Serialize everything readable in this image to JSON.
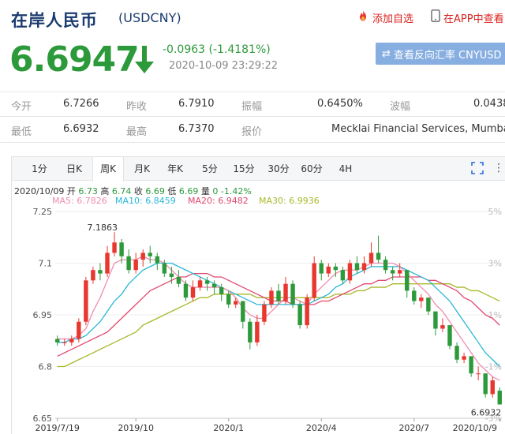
{
  "header": {
    "title": "在岸人民币",
    "code": "(USDCNY)",
    "add_fav": "添加自选",
    "app_view": "在APP中查看"
  },
  "quote": {
    "price": "6.6947",
    "change": "-0.0963 (-1.4181%)",
    "timestamp": "2020-10-09 23:29:22",
    "reverse_button": "查看反向汇率 CNYUSD"
  },
  "stats": {
    "open_label": "今开",
    "open": "6.7266",
    "prev_label": "昨收",
    "prev": "6.7910",
    "amp_label": "振幅",
    "amp": "0.6450%",
    "vol_label": "波幅",
    "vol": "0.0438",
    "low_label": "最低",
    "low": "6.6932",
    "high_label": "最高",
    "high": "6.7370",
    "quote_label": "报价",
    "quoter": "Mecklai Financial Services, Mumbai"
  },
  "tabs": [
    {
      "label": "1分"
    },
    {
      "label": "日K"
    },
    {
      "label": "周K"
    },
    {
      "label": "月K"
    },
    {
      "label": "年K"
    },
    {
      "label": "5分"
    },
    {
      "label": "15分"
    },
    {
      "label": "30分"
    },
    {
      "label": "60分"
    },
    {
      "label": "4H"
    }
  ],
  "active_tab": "周K",
  "ohlc": {
    "date": "2020/10/09",
    "open_label": "开",
    "open": "6.73",
    "high_label": "高",
    "high": "6.74",
    "close_label": "收",
    "close": "6.69",
    "low_label": "低",
    "low": "6.69",
    "volume_label": "量",
    "volume": "0",
    "change": "-1.42%"
  },
  "ma_legend": [
    {
      "label": "MA5: 6.7826",
      "color": "#f08cb0"
    },
    {
      "label": "MA10: 6.8459",
      "color": "#2ab7d6"
    },
    {
      "label": "MA20: 6.9482",
      "color": "#e0486e"
    },
    {
      "label": "MA30: 6.9936",
      "color": "#a8b82a"
    }
  ],
  "colors": {
    "up": "#e8372f",
    "down": "#2c9a3a",
    "accent": "#1a3a6e",
    "button": "#87aee0"
  },
  "chart_data": {
    "type": "candlestick",
    "title": "",
    "ylim": [
      6.65,
      7.25
    ],
    "y_ticks": [
      "7.25",
      "7.1",
      "6.95",
      "6.8",
      "6.65"
    ],
    "pct_ticks": [
      "5%",
      "3%",
      "1%",
      "-1%",
      "-3%"
    ],
    "x_ticks": [
      "2019/7/19",
      "2019/10",
      "2020/1",
      "2020/4",
      "2020/7",
      "2020/10/9"
    ],
    "x_tick_index": [
      0,
      11,
      24,
      37,
      50,
      62
    ],
    "annotations": {
      "max": "7.1863",
      "min": "6.6932"
    },
    "candles": [
      [
        6.88,
        6.87,
        6.89,
        6.86
      ],
      [
        6.87,
        6.87,
        6.88,
        6.86
      ],
      [
        6.87,
        6.88,
        6.89,
        6.86
      ],
      [
        6.88,
        6.93,
        6.94,
        6.87
      ],
      [
        6.93,
        7.05,
        7.06,
        6.92
      ],
      [
        7.05,
        7.08,
        7.09,
        7.04
      ],
      [
        7.08,
        7.07,
        7.1,
        7.05
      ],
      [
        7.07,
        7.13,
        7.15,
        7.06
      ],
      [
        7.13,
        7.16,
        7.19,
        7.12
      ],
      [
        7.16,
        7.12,
        7.17,
        7.1
      ],
      [
        7.12,
        7.08,
        7.14,
        7.07
      ],
      [
        7.08,
        7.11,
        7.13,
        7.07
      ],
      [
        7.11,
        7.13,
        7.14,
        7.09
      ],
      [
        7.13,
        7.12,
        7.15,
        7.1
      ],
      [
        7.12,
        7.1,
        7.13,
        7.08
      ],
      [
        7.1,
        7.07,
        7.11,
        7.06
      ],
      [
        7.07,
        7.06,
        7.09,
        7.04
      ],
      [
        7.06,
        7.04,
        7.08,
        7.03
      ],
      [
        7.04,
        7.0,
        7.05,
        6.99
      ],
      [
        7.0,
        7.03,
        7.05,
        6.99
      ],
      [
        7.03,
        7.05,
        7.06,
        7.02
      ],
      [
        7.05,
        7.04,
        7.06,
        7.02
      ],
      [
        7.04,
        7.03,
        7.05,
        7.01
      ],
      [
        7.03,
        7.01,
        7.04,
        6.99
      ],
      [
        7.01,
        6.98,
        7.02,
        6.97
      ],
      [
        6.98,
        6.99,
        7.0,
        6.97
      ],
      [
        6.99,
        6.93,
        6.99,
        6.91
      ],
      [
        6.93,
        6.87,
        6.94,
        6.85
      ],
      [
        6.87,
        6.93,
        6.95,
        6.86
      ],
      [
        6.93,
        6.98,
        6.99,
        6.92
      ],
      [
        6.98,
        7.02,
        7.03,
        6.97
      ],
      [
        7.02,
        6.99,
        7.04,
        6.98
      ],
      [
        6.99,
        7.04,
        7.06,
        6.98
      ],
      [
        7.04,
        6.98,
        7.05,
        6.97
      ],
      [
        6.98,
        6.92,
        6.99,
        6.91
      ],
      [
        6.92,
        7.0,
        7.01,
        6.91
      ],
      [
        7.0,
        7.1,
        7.12,
        6.99
      ],
      [
        7.1,
        7.07,
        7.11,
        7.05
      ],
      [
        7.07,
        7.09,
        7.1,
        7.06
      ],
      [
        7.09,
        7.08,
        7.1,
        7.06
      ],
      [
        7.08,
        7.05,
        7.09,
        7.04
      ],
      [
        7.05,
        7.1,
        7.11,
        7.04
      ],
      [
        7.1,
        7.08,
        7.12,
        7.07
      ],
      [
        7.08,
        7.1,
        7.12,
        7.07
      ],
      [
        7.1,
        7.13,
        7.16,
        7.09
      ],
      [
        7.13,
        7.11,
        7.18,
        7.1
      ],
      [
        7.11,
        7.08,
        7.12,
        7.07
      ],
      [
        7.08,
        7.07,
        7.09,
        7.05
      ],
      [
        7.07,
        7.08,
        7.1,
        7.06
      ],
      [
        7.08,
        7.02,
        7.08,
        7.0
      ],
      [
        7.02,
        6.99,
        7.03,
        6.98
      ],
      [
        6.99,
        7.0,
        7.01,
        6.97
      ],
      [
        7.0,
        6.96,
        7.0,
        6.95
      ],
      [
        6.96,
        6.91,
        6.96,
        6.89
      ],
      [
        6.91,
        6.92,
        6.94,
        6.9
      ],
      [
        6.92,
        6.86,
        6.92,
        6.85
      ],
      [
        6.86,
        6.82,
        6.87,
        6.81
      ],
      [
        6.82,
        6.83,
        6.84,
        6.81
      ],
      [
        6.83,
        6.78,
        6.83,
        6.77
      ],
      [
        6.78,
        6.78,
        6.8,
        6.76
      ],
      [
        6.78,
        6.72,
        6.78,
        6.71
      ],
      [
        6.72,
        6.76,
        6.77,
        6.71
      ],
      [
        6.73,
        6.69,
        6.74,
        6.69
      ]
    ],
    "ma5": [
      6.88,
      6.88,
      6.88,
      6.89,
      6.91,
      6.96,
      7.0,
      7.05,
      7.1,
      7.11,
      7.11,
      7.11,
      7.12,
      7.11,
      7.11,
      7.1,
      7.08,
      7.06,
      7.04,
      7.03,
      7.03,
      7.03,
      7.03,
      7.03,
      7.02,
      7.0,
      6.97,
      6.95,
      6.94,
      6.94,
      6.96,
      6.98,
      7.0,
      7.0,
      6.99,
      6.98,
      7.01,
      7.03,
      7.05,
      7.07,
      7.08,
      7.08,
      7.08,
      7.09,
      7.1,
      7.1,
      7.1,
      7.1,
      7.09,
      7.07,
      7.05,
      7.03,
      7.01,
      6.98,
      6.96,
      6.93,
      6.9,
      6.87,
      6.84,
      6.81,
      6.79,
      6.77,
      6.76
    ],
    "ma10": [
      6.87,
      6.87,
      6.88,
      6.88,
      6.89,
      6.91,
      6.93,
      6.96,
      6.99,
      7.01,
      7.04,
      7.06,
      7.08,
      7.09,
      7.1,
      7.1,
      7.1,
      7.09,
      7.08,
      7.07,
      7.06,
      7.05,
      7.04,
      7.03,
      7.02,
      7.01,
      7.0,
      6.99,
      6.98,
      6.98,
      6.98,
      6.98,
      6.98,
      6.98,
      6.98,
      6.98,
      6.99,
      7.0,
      7.01,
      7.03,
      7.04,
      7.06,
      7.07,
      7.08,
      7.09,
      7.09,
      7.09,
      7.09,
      7.09,
      7.08,
      7.07,
      7.06,
      7.05,
      7.03,
      7.01,
      6.99,
      6.96,
      6.93,
      6.9,
      6.87,
      6.84,
      6.82,
      6.8
    ],
    "ma20": [
      6.83,
      6.84,
      6.85,
      6.86,
      6.87,
      6.88,
      6.89,
      6.9,
      6.92,
      6.94,
      6.96,
      6.98,
      7.0,
      7.02,
      7.03,
      7.04,
      7.05,
      7.06,
      7.06,
      7.07,
      7.07,
      7.07,
      7.06,
      7.06,
      7.05,
      7.04,
      7.03,
      7.02,
      7.01,
      7.0,
      6.99,
      6.99,
      6.99,
      6.98,
      6.98,
      6.98,
      6.98,
      6.99,
      6.99,
      7.0,
      7.01,
      7.02,
      7.03,
      7.04,
      7.04,
      7.05,
      7.05,
      7.06,
      7.06,
      7.06,
      7.06,
      7.06,
      7.05,
      7.05,
      7.04,
      7.03,
      7.02,
      7.0,
      6.99,
      6.97,
      6.95,
      6.94,
      6.92
    ],
    "ma30": [
      6.8,
      6.8,
      6.81,
      6.82,
      6.83,
      6.84,
      6.85,
      6.86,
      6.87,
      6.88,
      6.89,
      6.9,
      6.92,
      6.93,
      6.94,
      6.95,
      6.96,
      6.97,
      6.98,
      6.99,
      7.0,
      7.0,
      7.01,
      7.01,
      7.01,
      7.01,
      7.01,
      7.01,
      7.0,
      7.0,
      7.0,
      7.0,
      7.0,
      7.0,
      7.0,
      7.0,
      7.0,
      7.0,
      7.0,
      7.01,
      7.01,
      7.01,
      7.02,
      7.02,
      7.03,
      7.03,
      7.03,
      7.04,
      7.04,
      7.04,
      7.04,
      7.04,
      7.04,
      7.04,
      7.04,
      7.04,
      7.03,
      7.03,
      7.02,
      7.02,
      7.01,
      7.0,
      6.99
    ]
  }
}
